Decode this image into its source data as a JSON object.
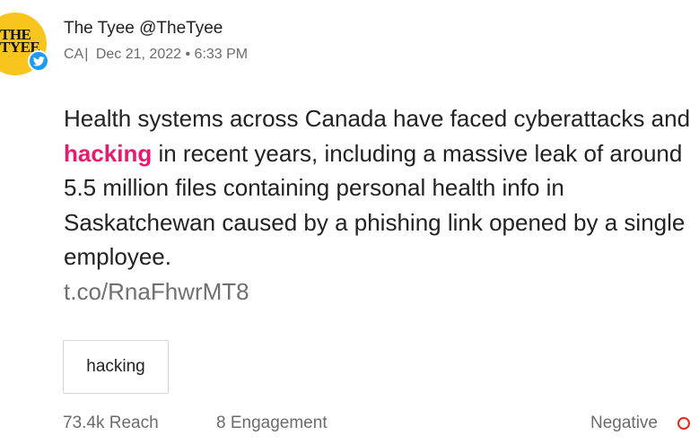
{
  "post": {
    "avatar": {
      "logo_lines": [
        "THE",
        "TYEE"
      ],
      "brand_color": "#f7c51e",
      "badge_icon": "twitter-bird-icon",
      "badge_color": "#1d9bf0"
    },
    "author": "The Tyee @TheTyee",
    "meta": {
      "country": "CA",
      "separator": "|",
      "date": "Dec 21, 2022",
      "dot": "•",
      "time": "6:33 PM"
    },
    "body": {
      "before": "Health systems across Canada have faced cyberattacks and ",
      "keyword": "hacking",
      "after": " in recent years, including a massive leak of around 5.5 million files containing personal health info in Saskatchewan caused by a phishing link opened by a single employee.",
      "link": "t.co/RnaFhwrMT8",
      "highlight_color": "#e8196e"
    },
    "tags": [
      "hacking"
    ],
    "footer": {
      "reach": "73.4k Reach",
      "engagement": "8 Engagement",
      "sentiment": "Negative",
      "sentiment_icon": "negative-ring-icon",
      "sentiment_color": "#e8271e"
    }
  }
}
